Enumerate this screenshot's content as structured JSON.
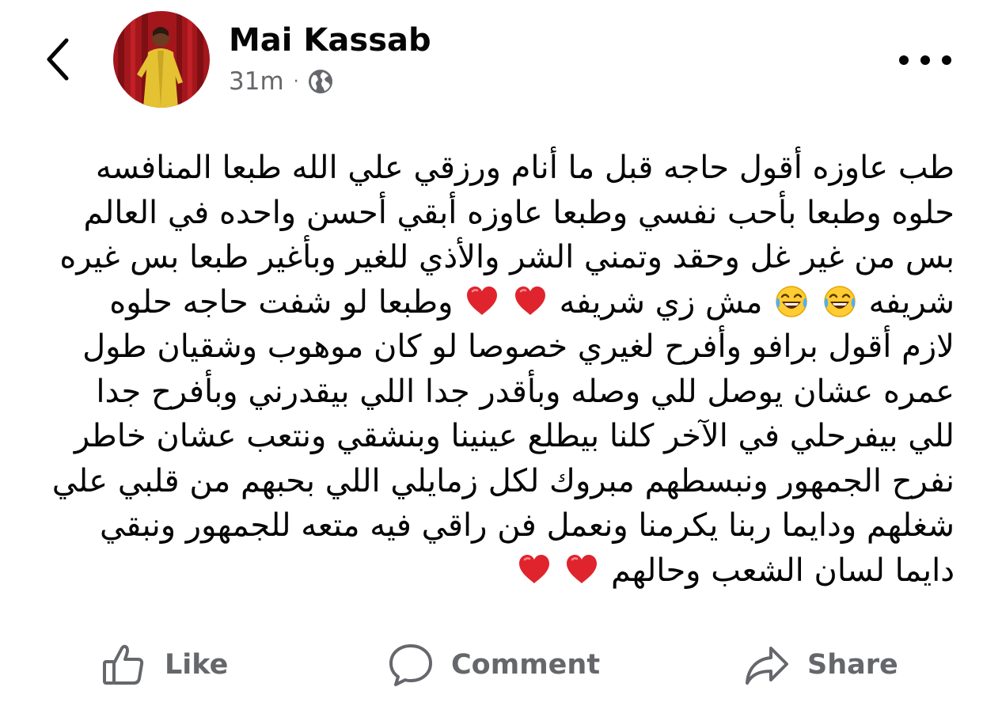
{
  "header": {
    "author_name": "Mai Kassab",
    "timestamp": "31m",
    "separator": "·",
    "back_icon": "chevron-left-icon",
    "audience_icon": "globe-icon",
    "more_icon": "more-horizontal-icon"
  },
  "post": {
    "lines": [
      "طب عاوزه أقول حاجه قبل ما أنام ورزقي علي الله طبعا المنافسه",
      "حلوه وطبعا بأحب نفسي وطبعا عاوزه أبقي أحسن واحده في العالم",
      "بس من غير غل وحقد وتمني الشر والأذي للغير وبأغير طبعا بس غيره",
      "شريفه",
      "مش زي شريفه",
      "وطبعا لو شفت حاجه حلوه",
      "لازم أقول برافو وأفرح لغيري خصوصا لو كان موهوب وشقيان طول",
      "عمره عشان يوصل للي وصله وبأقدر جدا اللي بيقدرني وبأفرح جدا",
      "للي بيفرحلي في الآخر كلنا بيطلع عينينا وبنشقي ونتعب عشان خاطر",
      "نفرح الجمهور ونبسطهم مبروك لكل زمايلي اللي بحبهم من قلبي علي",
      "شغلهم ودايما ربنا يكرمنا ونعمل فن راقي فيه متعه للجمهور ونبقي",
      "دايما لسان  الشعب وحالهم"
    ],
    "emoji": {
      "laugh": "face-with-tears-of-joy",
      "heart": "red-heart"
    }
  },
  "actions": {
    "like": {
      "label": "Like",
      "icon": "thumbs-up-icon"
    },
    "comment": {
      "label": "Comment",
      "icon": "comment-bubble-icon"
    },
    "share": {
      "label": "Share",
      "icon": "share-arrow-icon"
    }
  },
  "colors": {
    "text_primary": "#050505",
    "text_secondary": "#65676b",
    "heart": "#e0242e",
    "emoji_yellow": "#ffcc33"
  }
}
